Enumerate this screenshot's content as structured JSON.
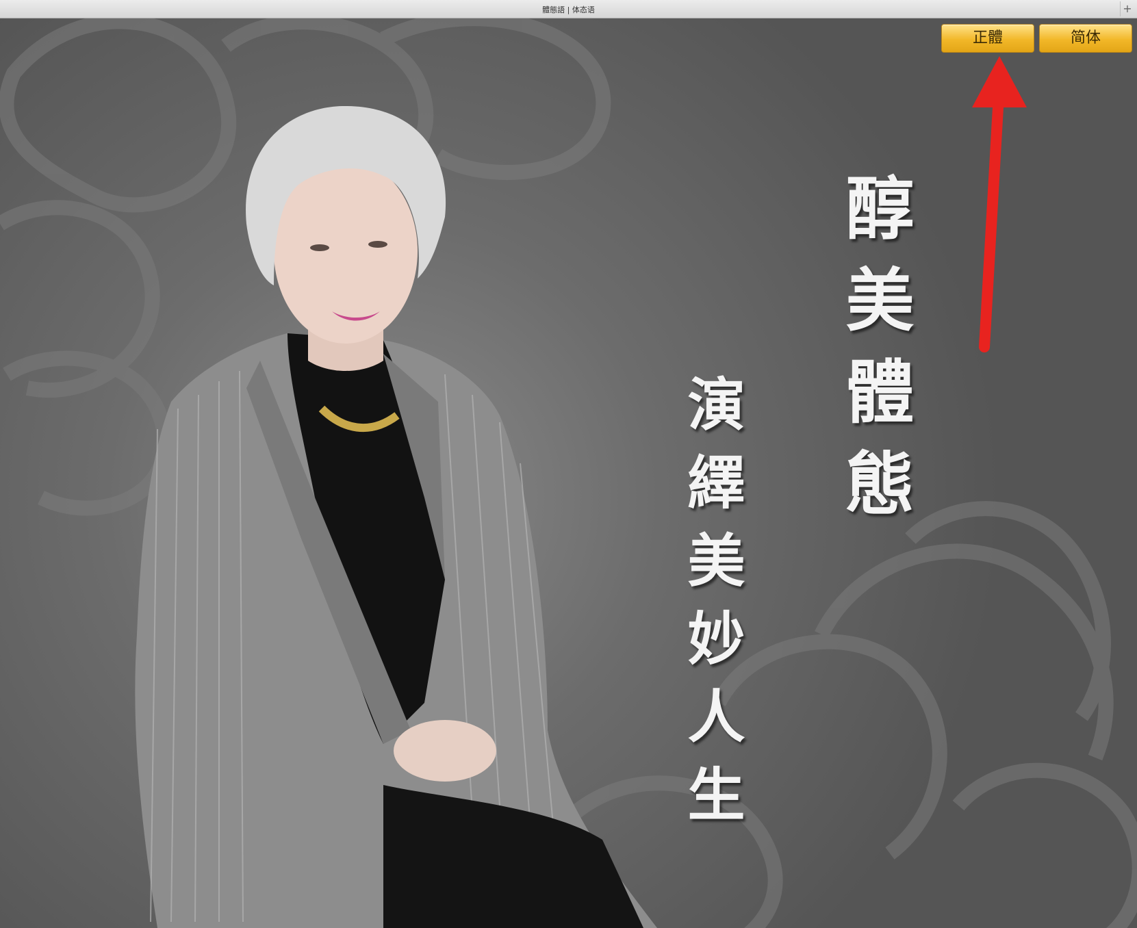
{
  "window": {
    "title": "體態語 | 体态语",
    "new_tab_label": "+"
  },
  "language_buttons": {
    "traditional": "正體",
    "simplified": "简体"
  },
  "banner": {
    "headline": "醇美體態",
    "subline": "演繹美妙人生"
  },
  "colors": {
    "button_gold": "#f2b829",
    "annotation_arrow": "#e8231f",
    "text": "#f4f4f4"
  }
}
